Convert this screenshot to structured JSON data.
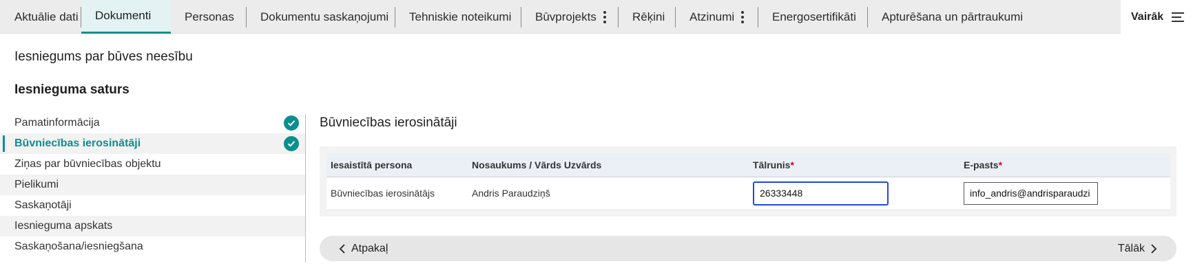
{
  "tabs": [
    {
      "label": "Aktuālie dati",
      "active": false,
      "kebab": false
    },
    {
      "label": "Dokumenti",
      "active": true,
      "kebab": false
    },
    {
      "label": "Personas",
      "active": false,
      "kebab": false
    },
    {
      "label": "Dokumentu saskaņojumi",
      "active": false,
      "kebab": false
    },
    {
      "label": "Tehniskie noteikumi",
      "active": false,
      "kebab": false
    },
    {
      "label": "Būvprojekts",
      "active": false,
      "kebab": true
    },
    {
      "label": "Rēķini",
      "active": false,
      "kebab": false
    },
    {
      "label": "Atzinumi",
      "active": false,
      "kebab": true
    },
    {
      "label": "Energosertifikāti",
      "active": false,
      "kebab": false
    },
    {
      "label": "Apturēšana un pārtraukumi",
      "active": false,
      "kebab": false
    }
  ],
  "more_label": "Vairāk",
  "page_title": "Iesniegums par būves neesību",
  "content_title": "Iesnieguma saturs",
  "nav_items": [
    {
      "label": "Pamatinformācija",
      "completed": true
    },
    {
      "label": "Būvniecības ierosinātāji",
      "completed": true
    },
    {
      "label": "Ziņas par būvniecības objektu",
      "completed": false
    },
    {
      "label": "Pielikumi",
      "completed": false
    },
    {
      "label": "Saskaņotāji",
      "completed": false
    },
    {
      "label": "Iesnieguma apskats",
      "completed": false
    },
    {
      "label": "Saskaņošana/iesniegšana",
      "completed": false
    }
  ],
  "section_title": "Būvniecības ierosinātāji",
  "table": {
    "headers": {
      "person": "Iesaistītā persona",
      "name": "Nosaukums / Vārds Uzvārds",
      "phone": "Tālrunis",
      "email": "E-pasts",
      "required_mark": "*"
    },
    "rows": [
      {
        "person": "Būvniecības ierosinātājs",
        "name": "Andris Paraudziņš",
        "phone": "26333448",
        "email": "info_andris@andrisparaudzi"
      }
    ]
  },
  "pager": {
    "back_label": "Atpakaļ",
    "next_label": "Tālāk"
  },
  "colors": {
    "accent": "#0b8f8d",
    "required": "#d0021b",
    "focus": "#1f49d8"
  }
}
